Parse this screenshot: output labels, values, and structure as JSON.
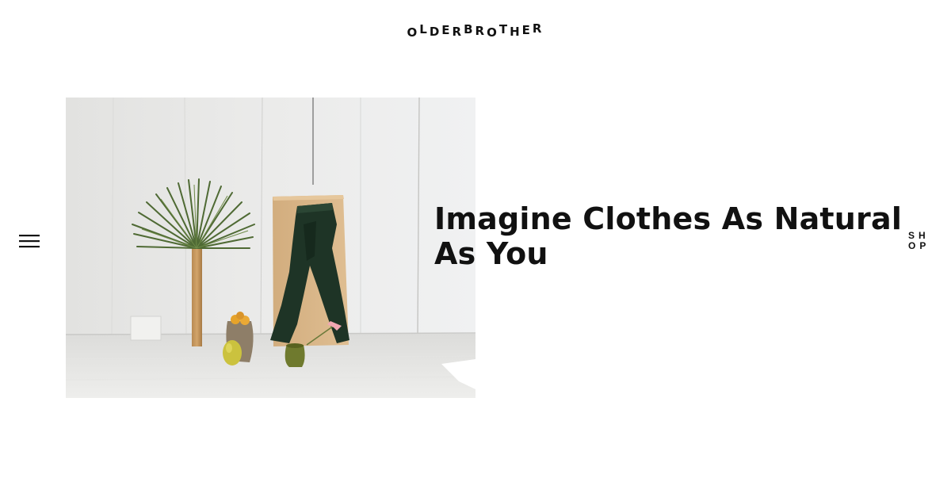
{
  "header": {
    "logo_letters": [
      "O",
      "L",
      "D",
      "E",
      "R",
      "B",
      "R",
      "O",
      "T",
      "H",
      "E",
      "R"
    ]
  },
  "nav": {
    "menu_icon": "hamburger-menu-icon",
    "shop_label_line1": "SH",
    "shop_label_line2": "OP"
  },
  "hero": {
    "headline": "Imagine Clothes As Natural As You"
  },
  "colors": {
    "text": "#111111",
    "background": "#ffffff",
    "wall": "#e6e6e4",
    "board": "#d8b588",
    "trousers": "#1e3426",
    "palm": "#4f6a34"
  }
}
